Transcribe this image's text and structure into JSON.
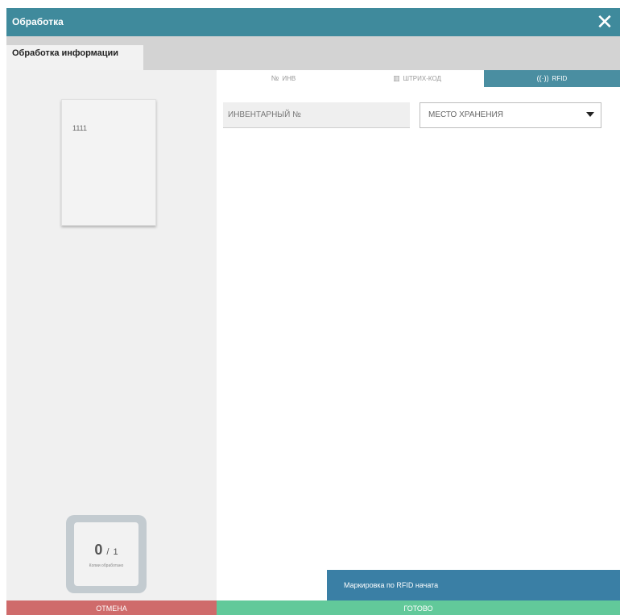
{
  "dialog": {
    "title": "Обработка",
    "close_symbol": "✕",
    "section_label": "Обработка информации"
  },
  "document": {
    "number": "1111"
  },
  "counter": {
    "done": "0",
    "separator": "/",
    "total": "1",
    "caption": "Копии обработано"
  },
  "tabs": [
    {
      "icon": "№",
      "label": "ИНВ"
    },
    {
      "icon": "▥",
      "label": "ШТРИХ-КОД"
    },
    {
      "icon": "((·))",
      "label": "RFID",
      "active": true
    }
  ],
  "fields": {
    "inventory_placeholder": "ИНВЕНТАРНЫЙ №",
    "location_placeholder": "МЕСТО ХРАНЕНИЯ"
  },
  "toast": {
    "text": "Маркировка по RFID начата"
  },
  "buttons": {
    "cancel": "ОТМЕНА",
    "done": "ГОТОВО"
  },
  "colors": {
    "titlebar": "#3f8a9c",
    "tab_active": "#4a8ea1",
    "cancel": "#cf6b6b",
    "done": "#62c99a",
    "toast": "#3a7fa5"
  }
}
